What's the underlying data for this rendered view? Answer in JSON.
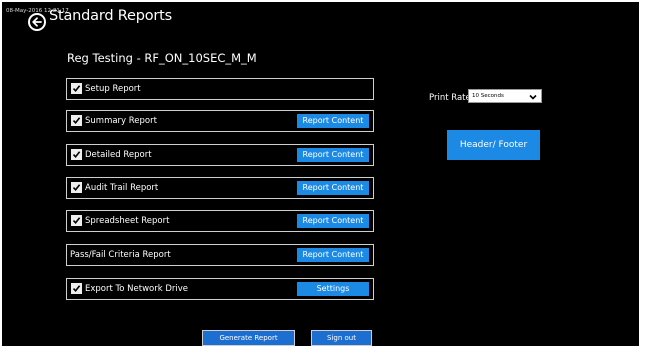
{
  "header": {
    "timestamp": "08-May-2016 12:21:17",
    "title": "Standard Reports",
    "back_icon": "back-arrow-icon"
  },
  "test_name": "Reg Testing - RF_ON_10SEC_M_M",
  "reports": [
    {
      "label": "Setup Report",
      "checked": true,
      "button": null
    },
    {
      "label": "Summary Report",
      "checked": true,
      "button": "Report Content"
    },
    {
      "label": "Detailed Report",
      "checked": true,
      "button": "Report Content"
    },
    {
      "label": "Audit Trail Report",
      "checked": true,
      "button": "Report Content"
    },
    {
      "label": "Spreadsheet Report",
      "checked": true,
      "button": "Report Content"
    },
    {
      "label": "Pass/Fail Criteria Report",
      "checked": false,
      "button": "Report Content"
    },
    {
      "label": "Export To Network Drive",
      "checked": true,
      "button": "Settings"
    }
  ],
  "print_rate": {
    "label": "Print Rate",
    "value": "10 Seconds"
  },
  "header_footer_label": "Header/ Footer",
  "footer": {
    "generate_label": "Generate Report",
    "signout_label": "Sign out"
  },
  "colors": {
    "background": "#000000",
    "accent": "#1c8ae4",
    "text": "#ffffff"
  }
}
